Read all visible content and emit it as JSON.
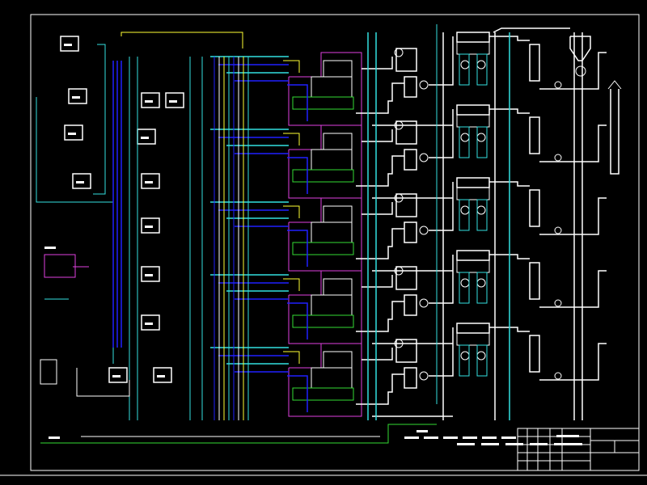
{
  "drawing": {
    "type": "process flow diagram (CAD)",
    "background": "#000000",
    "colors": {
      "frame": "#ffffff",
      "equipment": "#ffffff",
      "pipe_cyan": "#33e0e0",
      "pipe_blue": "#2020ff",
      "pipe_green": "#33dd33",
      "pipe_yellow": "#ffff33",
      "unit_outline": "#e040e0",
      "text": "#ffffff"
    },
    "components": [
      "pump-icon",
      "tank-icon",
      "boiler-icon",
      "dust-collector-icon",
      "chimney-icon",
      "stack-icon",
      "silo-icon",
      "title-block"
    ],
    "legibility_note_hidden": ""
  }
}
